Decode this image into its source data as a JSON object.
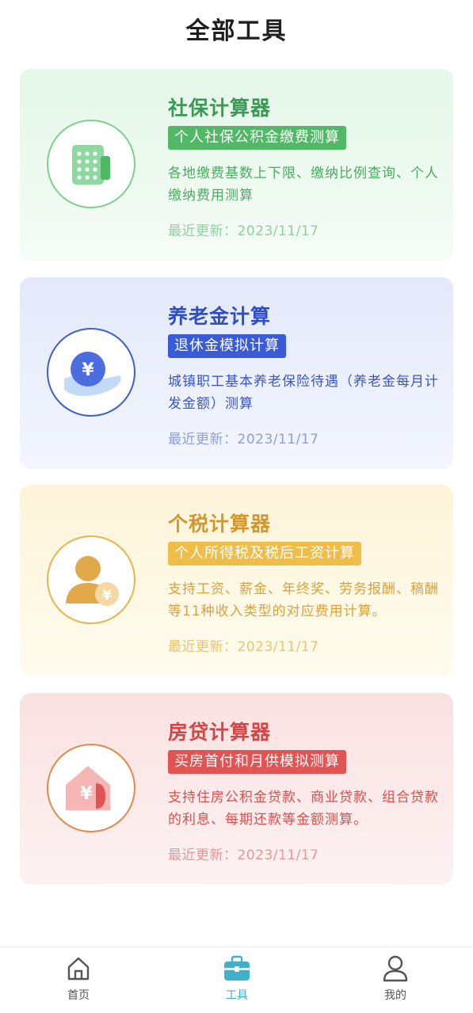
{
  "page": {
    "title": "全部工具"
  },
  "cards": [
    {
      "title": "社保计算器",
      "tag": "个人社保公积金缴费测算",
      "desc": "各地缴费基数上下限、缴纳比例查询、个人缴纳费用测算",
      "updated": "最近更新：2023/11/17",
      "icon": "calculator-icon"
    },
    {
      "title": "养老金计算",
      "tag": "退休金模拟计算",
      "desc": "城镇职工基本养老保险待遇（养老金每月计发金额）测算",
      "updated": "最近更新：2023/11/17",
      "icon": "yuan-coin-hand-icon"
    },
    {
      "title": "个税计算器",
      "tag": "个人所得税及税后工资计算",
      "desc": "支持工资、薪金、年终奖、劳务报酬、稿酬等11种收入类型的对应费用计算。",
      "updated": "最近更新：2023/11/17",
      "icon": "person-yuan-icon"
    },
    {
      "title": "房贷计算器",
      "tag": "买房首付和月供模拟测算",
      "desc": "支持住房公积金贷款、商业贷款、组合贷款的利息、每期还款等金额测算。",
      "updated": "最近更新：2023/11/17",
      "icon": "house-yuan-icon"
    }
  ],
  "icon_glyph": "¥",
  "tabbar": {
    "home": "首页",
    "tools": "工具",
    "mine": "我的",
    "active": "tools"
  },
  "colors": {
    "green": "#52b866",
    "blue": "#3a5bd6",
    "yellow": "#efbd4a",
    "red": "#e05454",
    "tab_active": "#3fb1c9"
  }
}
